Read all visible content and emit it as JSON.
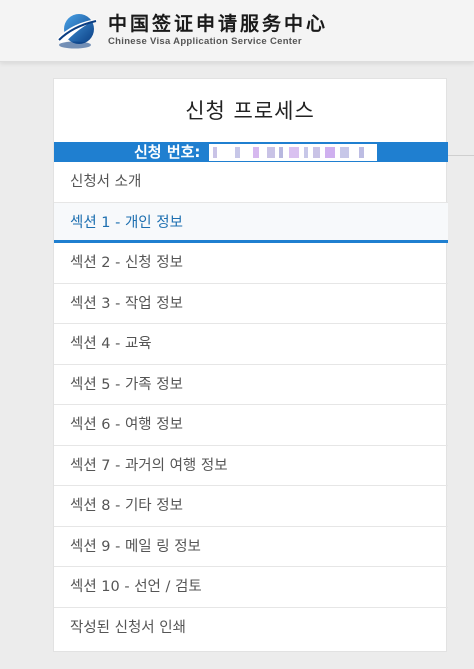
{
  "brand": {
    "name_cn": "中国签证申请服务中心",
    "name_en": "Chinese Visa Application Service Center"
  },
  "panel": {
    "title": "신청 프로세스",
    "application_number_label": "신청 번호:"
  },
  "nav": {
    "items": [
      {
        "label": "신청서 소개"
      },
      {
        "label": "섹션 1 - 개인 정보"
      },
      {
        "label": "섹션 2 - 신청 정보"
      },
      {
        "label": "섹션 3 - 작업 정보"
      },
      {
        "label": "섹션 4 - 교육"
      },
      {
        "label": "섹션 5 - 가족 정보"
      },
      {
        "label": "섹션 6 - 여행 정보"
      },
      {
        "label": "섹션 7 - 과거의 여행 정보"
      },
      {
        "label": "섹션 8 - 기타 정보"
      },
      {
        "label": "섹션 9 - 메일 링 정보"
      },
      {
        "label": "섹션 10 - 선언 / 검토"
      },
      {
        "label": "작성된 신청서 인쇄"
      }
    ],
    "active_index": 1
  },
  "colors": {
    "accent": "#1f7fd0",
    "active_text": "#1d6fb0"
  }
}
